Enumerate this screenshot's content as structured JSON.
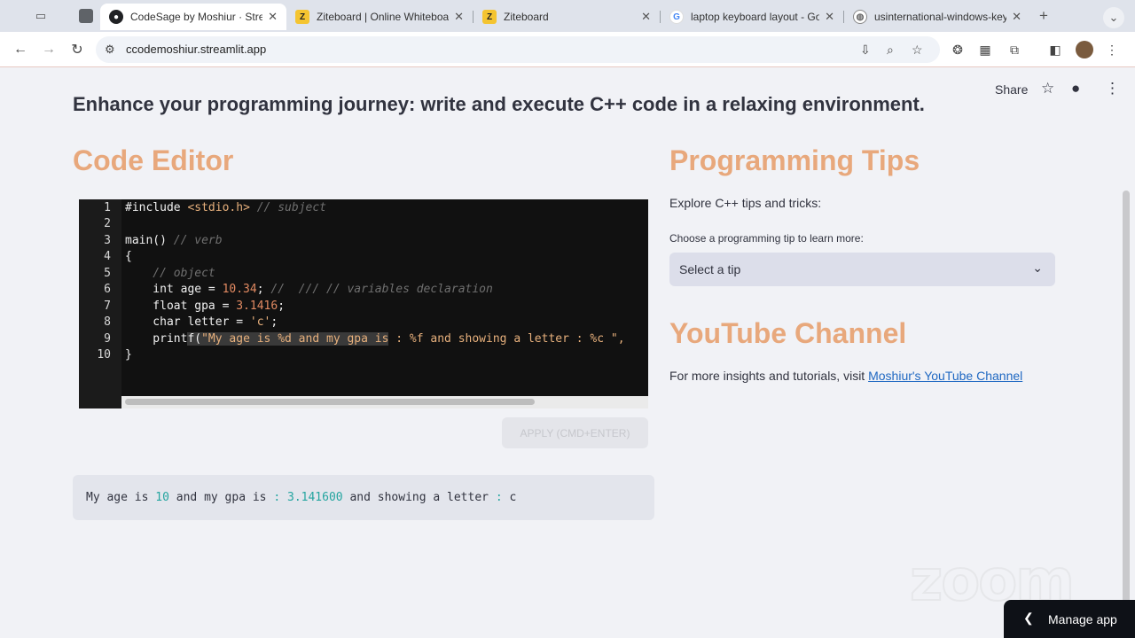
{
  "browser": {
    "tabs": [
      {
        "title": "CodeSage by Moshiur · Strea",
        "favicon": "streamlit-icon",
        "active": true
      },
      {
        "title": "Ziteboard | Online Whiteboar",
        "favicon": "ziteboard-icon",
        "active": false
      },
      {
        "title": "Ziteboard",
        "favicon": "ziteboard-icon",
        "active": false
      },
      {
        "title": "laptop keyboard layout - Goo",
        "favicon": "google-icon",
        "active": false
      },
      {
        "title": "usinternational-windows-key",
        "favicon": "globe-icon",
        "active": false
      }
    ],
    "new_tab": "+",
    "url": "ccodemoshiur.streamlit.app"
  },
  "app": {
    "clipped_heading": "Enhance your programming journey: write and execute C++ code in a relaxing environment.",
    "share_label": "Share",
    "editor": {
      "title": "Code Editor",
      "line_numbers": [
        "1",
        "2",
        "3",
        "4",
        "5",
        "6",
        "7",
        "8",
        "9",
        "10"
      ],
      "apply_label": "APPLY (CMD+ENTER)"
    },
    "output": {
      "p1": "My age is ",
      "n1": "10",
      "p2": " and my gpa is ",
      "c1": ":",
      "n2": " 3.141600",
      "p3": " and showing a letter ",
      "c2": ":",
      "p4": " c"
    },
    "tips": {
      "title": "Programming Tips",
      "subtitle": "Explore C++ tips and tricks:",
      "select_label": "Choose a programming tip to learn more:",
      "select_value": "Select a tip"
    },
    "youtube": {
      "title": "YouTube Channel",
      "text": "For more insights and tutorials, visit ",
      "link": "Moshiur's YouTube Channel"
    },
    "manage_label": "Manage app",
    "watermark": "zoom"
  },
  "colors": {
    "accent_heading": "#e8a87c",
    "editor_bg": "#111111",
    "link": "#1f68c2",
    "output_number": "#25a5a0"
  }
}
